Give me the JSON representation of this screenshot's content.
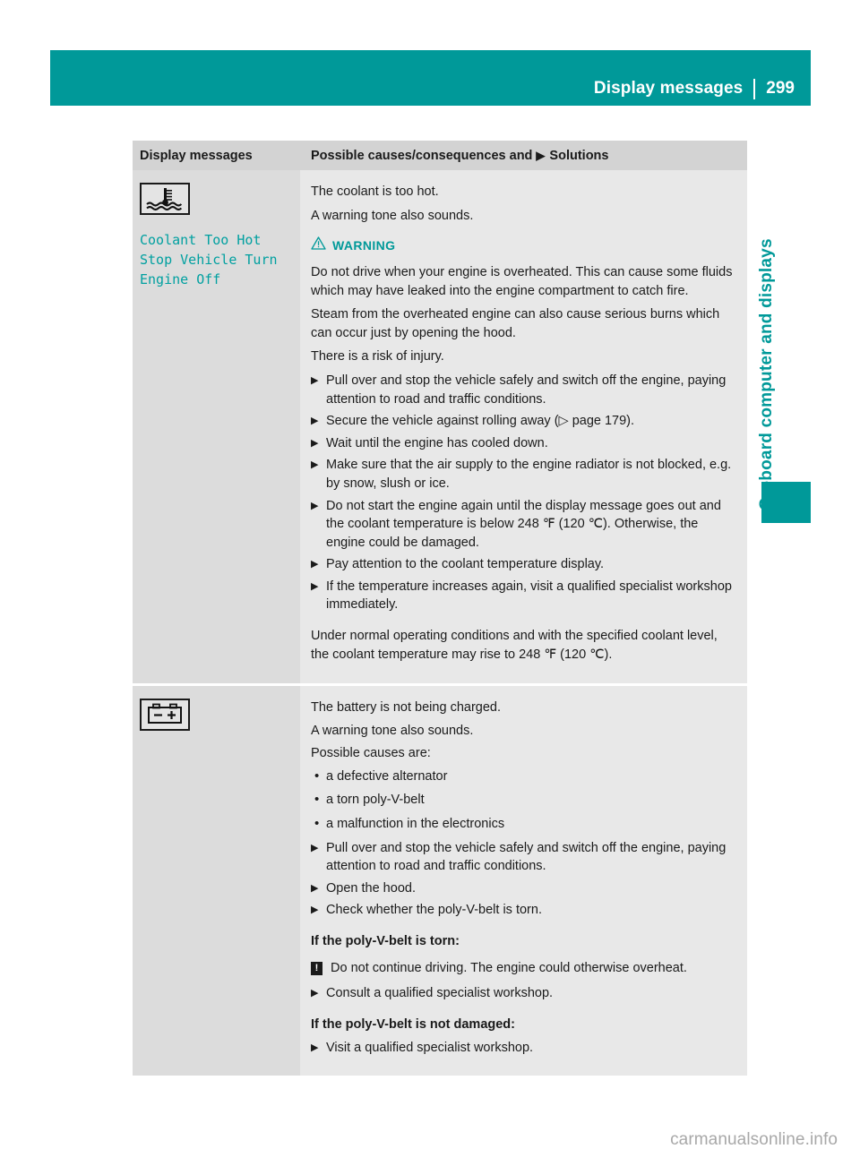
{
  "header": {
    "title": "Display messages",
    "page_number": "299"
  },
  "side": {
    "chapter_label": "On-board computer and displays"
  },
  "table": {
    "columns": {
      "left": "Display messages",
      "right_prefix": "Possible causes/consequences and",
      "right_marker": "▶",
      "right_suffix": "Solutions"
    },
    "rows": [
      {
        "icon": "coolant-temperature-icon",
        "display_message": "Coolant Too Hot\nStop Vehicle Turn\nEngine Off",
        "intro": [
          "The coolant is too hot.",
          "A warning tone also sounds."
        ],
        "warning": {
          "label": "WARNING",
          "icon": "warning-triangle-icon",
          "paragraphs": [
            "Do not drive when your engine is overheated. This can cause some fluids which may have leaked into the engine compartment to catch fire.",
            "Steam from the overheated engine can also cause serious burns which can occur just by opening the hood.",
            "There is a risk of injury."
          ]
        },
        "steps": [
          "Pull over and stop the vehicle safely and switch off the engine, paying attention to road and traffic conditions.",
          "Secure the vehicle against rolling away (▷ page 179).",
          "Wait until the engine has cooled down.",
          "Make sure that the air supply to the engine radiator is not blocked, e.g. by snow, slush or ice.",
          "Do not start the engine again until the display message goes out and the coolant temperature is below 248 ℉ (120 ℃). Otherwise, the engine could be damaged.",
          "Pay attention to the coolant temperature display.",
          "If the temperature increases again, visit a qualified specialist workshop immediately."
        ],
        "closing": "Under normal operating conditions and with the specified coolant level, the coolant temperature may rise to 248 ℉ (120 ℃)."
      },
      {
        "icon": "battery-charge-icon",
        "display_message": "",
        "intro": [
          "The battery is not being charged.",
          "A warning tone also sounds.",
          "Possible causes are:"
        ],
        "causes": [
          "a defective alternator",
          "a torn poly-V-belt",
          "a malfunction in the electronics"
        ],
        "steps_a": [
          "Pull over and stop the vehicle safely and switch off the engine, paying attention to road and traffic conditions.",
          "Open the hood.",
          "Check whether the poly-V-belt is torn."
        ],
        "subhead_torn": "If the poly-V-belt is torn:",
        "note": "Do not continue driving. The engine could otherwise overheat.",
        "steps_b": [
          "Consult a qualified specialist workshop."
        ],
        "subhead_ok": "If the poly-V-belt is not damaged:",
        "steps_c": [
          "Visit a qualified specialist workshop."
        ]
      }
    ]
  },
  "footer": {
    "watermark": "carmanualsonline.info"
  },
  "markers": {
    "step": "▶",
    "dot": "•",
    "exclamation": "!"
  },
  "colors": {
    "accent": "#009999",
    "message_text": "#00a0a0",
    "header_band": "#009999",
    "left_cell_bg": "#dcdcdc",
    "right_cell_bg": "#e8e8e8",
    "head_bg": "#d3d3d3"
  }
}
